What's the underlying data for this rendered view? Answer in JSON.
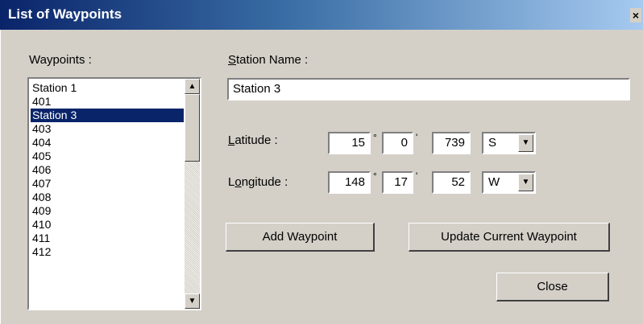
{
  "window": {
    "title": "List of Waypoints",
    "close_glyph": "×"
  },
  "waypoints": {
    "label": "Waypoints :",
    "items": [
      "Station 1",
      "401",
      "Station 3",
      "403",
      "404",
      "405",
      "406",
      "407",
      "408",
      "409",
      "410",
      "411",
      "412"
    ],
    "selected_index": 2
  },
  "station": {
    "label_accel": "S",
    "label_rest": "tation Name :",
    "value": "Station 3"
  },
  "latitude": {
    "label_accel": "L",
    "label_rest": "atitude :",
    "degrees": "15",
    "minutes": "0",
    "seconds": "739",
    "hemisphere": "S"
  },
  "longitude": {
    "label_pre": "L",
    "label_accel": "o",
    "label_rest": "ngitude :",
    "degrees": "148",
    "minutes": "17",
    "seconds": "52",
    "hemisphere": "W"
  },
  "symbols": {
    "degree": "°",
    "minute": "'"
  },
  "buttons": {
    "add": "Add Waypoint",
    "update": "Update Current Waypoint",
    "close": "Close"
  },
  "icons": {
    "scroll_up": "up-arrow-icon",
    "scroll_down": "down-arrow-icon",
    "dropdown": "dropdown-arrow-icon"
  }
}
